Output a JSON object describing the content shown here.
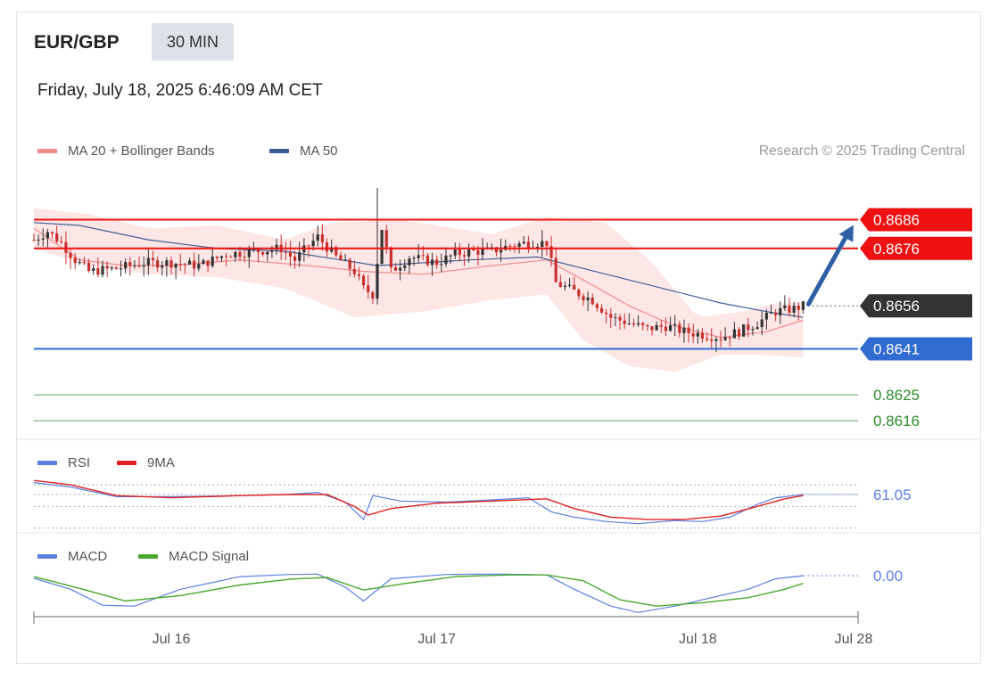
{
  "header": {
    "symbol": "EUR/GBP",
    "timeframe": "30 MIN",
    "datetime": "Friday, July 18, 2025 6:46:09 AM CET",
    "credit": "Research © 2025 Trading Central"
  },
  "colors": {
    "ma20": "#f08c8c",
    "ma50": "#3f5f95",
    "band_fill": "#fde2e2",
    "resistance": "#ee1111",
    "support": "#2f6bd0",
    "target": "#5aa85a",
    "target_text": "#2e8b2e",
    "price_label": "#333333",
    "arrow": "#2e5fa6",
    "candle_up": "#333333",
    "candle_down": "#c83030",
    "rsi": "#5a7fe0",
    "rsi_ma": "#e02020",
    "macd": "#5a7fe0",
    "macd_signal": "#48a82c"
  },
  "chart_data": [
    {
      "type": "candlestick",
      "title": "EUR/GBP",
      "legend": [
        {
          "name": "MA 20 + Bollinger Bands",
          "color": "#f08c8c"
        },
        {
          "name": "MA 50",
          "color": "#3f5f95"
        }
      ],
      "ylim": [
        0.8612,
        0.8702
      ],
      "levels": [
        {
          "value": 0.8686,
          "label": "0.8686",
          "kind": "resistance"
        },
        {
          "value": 0.8676,
          "label": "0.8676",
          "kind": "resistance"
        },
        {
          "value": 0.8656,
          "label": "0.8656",
          "kind": "last-price"
        },
        {
          "value": 0.8641,
          "label": "0.8641",
          "kind": "support"
        },
        {
          "value": 0.8625,
          "label": "0.8625",
          "kind": "target"
        },
        {
          "value": 0.8616,
          "label": "0.8616",
          "kind": "target"
        }
      ],
      "close_path": [
        [
          0,
          0.8679
        ],
        [
          3,
          0.8682
        ],
        [
          6,
          0.8678
        ],
        [
          9,
          0.8672
        ],
        [
          12,
          0.8668
        ],
        [
          18,
          0.8669
        ],
        [
          24,
          0.8671
        ],
        [
          30,
          0.8671
        ],
        [
          36,
          0.867
        ],
        [
          42,
          0.8674
        ],
        [
          48,
          0.8675
        ],
        [
          54,
          0.8676
        ],
        [
          57,
          0.8672
        ],
        [
          60,
          0.8677
        ],
        [
          62,
          0.868
        ],
        [
          66,
          0.8673
        ],
        [
          70,
          0.8668
        ],
        [
          72,
          0.8662
        ],
        [
          74,
          0.866
        ],
        [
          76,
          0.8683
        ],
        [
          78,
          0.8668
        ],
        [
          82,
          0.8673
        ],
        [
          88,
          0.8671
        ],
        [
          92,
          0.8674
        ],
        [
          96,
          0.8675
        ],
        [
          100,
          0.8675
        ],
        [
          104,
          0.8677
        ],
        [
          108,
          0.8678
        ],
        [
          112,
          0.8678
        ],
        [
          114,
          0.8664
        ],
        [
          118,
          0.8661
        ],
        [
          122,
          0.8658
        ],
        [
          126,
          0.8652
        ],
        [
          130,
          0.865
        ],
        [
          134,
          0.8648
        ],
        [
          138,
          0.8649
        ],
        [
          142,
          0.8647
        ],
        [
          146,
          0.8646
        ],
        [
          150,
          0.8645
        ],
        [
          154,
          0.8647
        ],
        [
          158,
          0.865
        ],
        [
          162,
          0.8654
        ],
        [
          166,
          0.8655
        ],
        [
          168,
          0.8656
        ]
      ],
      "spikes": [
        [
          75,
          0.8697
        ],
        [
          76,
          0.8681
        ]
      ],
      "ma20_path": [
        [
          0,
          0.8683
        ],
        [
          10,
          0.8672
        ],
        [
          20,
          0.867
        ],
        [
          30,
          0.867
        ],
        [
          45,
          0.8672
        ],
        [
          60,
          0.867
        ],
        [
          72,
          0.8668
        ],
        [
          85,
          0.8667
        ],
        [
          100,
          0.867
        ],
        [
          112,
          0.8672
        ],
        [
          120,
          0.8665
        ],
        [
          130,
          0.8656
        ],
        [
          140,
          0.8649
        ],
        [
          150,
          0.8645
        ],
        [
          160,
          0.8647
        ],
        [
          168,
          0.8651
        ]
      ],
      "ma50_path": [
        [
          0,
          0.8685
        ],
        [
          10,
          0.8684
        ],
        [
          25,
          0.8679
        ],
        [
          40,
          0.8676
        ],
        [
          55,
          0.8675
        ],
        [
          75,
          0.867
        ],
        [
          95,
          0.8672
        ],
        [
          110,
          0.8673
        ],
        [
          120,
          0.8669
        ],
        [
          130,
          0.8665
        ],
        [
          140,
          0.8661
        ],
        [
          150,
          0.8657
        ],
        [
          160,
          0.8654
        ],
        [
          168,
          0.8652
        ]
      ],
      "band_upper": [
        [
          0,
          0.869
        ],
        [
          12,
          0.8688
        ],
        [
          25,
          0.8683
        ],
        [
          40,
          0.8684
        ],
        [
          55,
          0.8679
        ],
        [
          65,
          0.8685
        ],
        [
          80,
          0.8686
        ],
        [
          100,
          0.8681
        ],
        [
          112,
          0.8687
        ],
        [
          125,
          0.8685
        ],
        [
          135,
          0.8671
        ],
        [
          145,
          0.8652
        ],
        [
          155,
          0.8654
        ],
        [
          162,
          0.8657
        ],
        [
          168,
          0.8657
        ]
      ],
      "band_lower": [
        [
          0,
          0.8676
        ],
        [
          12,
          0.867
        ],
        [
          25,
          0.8667
        ],
        [
          40,
          0.8666
        ],
        [
          55,
          0.8662
        ],
        [
          70,
          0.8652
        ],
        [
          85,
          0.8654
        ],
        [
          100,
          0.8658
        ],
        [
          112,
          0.866
        ],
        [
          120,
          0.8644
        ],
        [
          130,
          0.8635
        ],
        [
          140,
          0.8633
        ],
        [
          150,
          0.8639
        ],
        [
          158,
          0.8639
        ],
        [
          168,
          0.8638
        ]
      ],
      "projection": {
        "from": [
          168,
          0.8656
        ],
        "to": [
          179,
          0.8686
        ]
      },
      "x_ticks": [
        {
          "label": "Jul 16",
          "index": 30
        },
        {
          "label": "Jul 17",
          "index": 88
        },
        {
          "label": "Jul 18",
          "index": 145
        },
        {
          "label": "Jul 28",
          "index": 170
        }
      ]
    },
    {
      "type": "line",
      "legend": [
        {
          "name": "RSI",
          "color": "#5a7fe0"
        },
        {
          "name": "9MA",
          "color": "#e02020"
        }
      ],
      "ylim": [
        28,
        75
      ],
      "last_value": "61.05",
      "ref_lines": [
        70,
        61.05,
        50,
        30
      ],
      "series": [
        {
          "name": "RSI",
          "points": [
            [
              0,
              72
            ],
            [
              8,
              68
            ],
            [
              18,
              59
            ],
            [
              30,
              59
            ],
            [
              45,
              60
            ],
            [
              55,
              61
            ],
            [
              62,
              63
            ],
            [
              68,
              54
            ],
            [
              72,
              38
            ],
            [
              74,
              60
            ],
            [
              80,
              55
            ],
            [
              90,
              54
            ],
            [
              100,
              56
            ],
            [
              108,
              58
            ],
            [
              113,
              45
            ],
            [
              118,
              40
            ],
            [
              125,
              36
            ],
            [
              132,
              34
            ],
            [
              140,
              37
            ],
            [
              146,
              36
            ],
            [
              152,
              40
            ],
            [
              158,
              52
            ],
            [
              162,
              58
            ],
            [
              168,
              61
            ]
          ]
        },
        {
          "name": "9MA",
          "points": [
            [
              0,
              74
            ],
            [
              8,
              70
            ],
            [
              18,
              60
            ],
            [
              30,
              58
            ],
            [
              45,
              60
            ],
            [
              55,
              61
            ],
            [
              64,
              61
            ],
            [
              70,
              50
            ],
            [
              73,
              42
            ],
            [
              78,
              48
            ],
            [
              88,
              53
            ],
            [
              100,
              55
            ],
            [
              112,
              57
            ],
            [
              118,
              48
            ],
            [
              126,
              40
            ],
            [
              134,
              38
            ],
            [
              142,
              38
            ],
            [
              150,
              41
            ],
            [
              158,
              50
            ],
            [
              164,
              57
            ],
            [
              168,
              60
            ]
          ]
        }
      ]
    },
    {
      "type": "line",
      "legend": [
        {
          "name": "MACD",
          "color": "#5a7fe0"
        },
        {
          "name": "MACD Signal",
          "color": "#48a82c"
        }
      ],
      "ylim": [
        -0.00085,
        0.00025
      ],
      "last_value": "0.00",
      "series": [
        {
          "name": "MACD",
          "points": [
            [
              0,
              6e-05
            ],
            [
              8,
              -0.0002
            ],
            [
              15,
              -0.00058
            ],
            [
              22,
              -0.0006
            ],
            [
              32,
              -0.0002
            ],
            [
              45,
              0.0001
            ],
            [
              56,
              0.00015
            ],
            [
              62,
              0.00016
            ],
            [
              68,
              -0.00015
            ],
            [
              72,
              -0.00048
            ],
            [
              78,
              5e-05
            ],
            [
              90,
              0.00015
            ],
            [
              102,
              0.00016
            ],
            [
              108,
              0.00015
            ],
            [
              112,
              0.00014
            ],
            [
              118,
              -0.0002
            ],
            [
              126,
              -0.0006
            ],
            [
              132,
              -0.00075
            ],
            [
              140,
              -0.0006
            ],
            [
              148,
              -0.0004
            ],
            [
              156,
              -0.0002
            ],
            [
              162,
              5e-05
            ],
            [
              168,
              0.00012
            ]
          ]
        },
        {
          "name": "MACD Signal",
          "points": [
            [
              0,
              0.0001
            ],
            [
              10,
              -0.00018
            ],
            [
              20,
              -0.00048
            ],
            [
              32,
              -0.00035
            ],
            [
              45,
              -0.0001
            ],
            [
              56,
              4e-05
            ],
            [
              64,
              8e-05
            ],
            [
              72,
              -0.00022
            ],
            [
              80,
              -8e-05
            ],
            [
              92,
              0.0001
            ],
            [
              104,
              0.00014
            ],
            [
              112,
              0.00014
            ],
            [
              120,
              0.0
            ],
            [
              128,
              -0.00045
            ],
            [
              136,
              -0.0006
            ],
            [
              146,
              -0.00052
            ],
            [
              156,
              -0.0004
            ],
            [
              164,
              -0.0002
            ],
            [
              168,
              -6e-05
            ]
          ]
        }
      ]
    }
  ]
}
